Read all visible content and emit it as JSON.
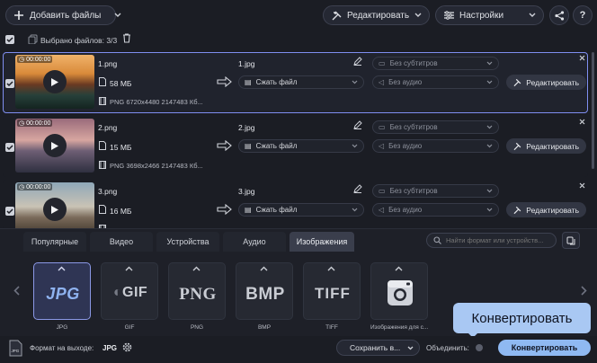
{
  "toolbar": {
    "add_files_label": "Добавить файлы",
    "edit_label": "Редактировать",
    "settings_label": "Настройки"
  },
  "selection": {
    "selected_label": "Выбрано файлов: 3/3"
  },
  "files": [
    {
      "duration": "00:00:00",
      "name": "1.png",
      "size": "58 МБ",
      "info": "PNG 6720x4480 2147483 Кб...",
      "output_name": "1.jpg",
      "compress_label": "Сжать файл",
      "subtitles_label": "Без субтитров",
      "audio_label": "Без аудио",
      "edit_label": "Редактировать"
    },
    {
      "duration": "00:00:00",
      "name": "2.png",
      "size": "15 МБ",
      "info": "PNG 3698x2466 2147483 Кб...",
      "output_name": "2.jpg",
      "compress_label": "Сжать файл",
      "subtitles_label": "Без субтитров",
      "audio_label": "Без аудио",
      "edit_label": "Редактировать"
    },
    {
      "duration": "00:00:00",
      "name": "3.png",
      "size": "16 МБ",
      "info": "",
      "output_name": "3.jpg",
      "compress_label": "Сжать файл",
      "subtitles_label": "Без субтитров",
      "audio_label": "Без аудио",
      "edit_label": "Редактировать"
    }
  ],
  "tabs": [
    {
      "label": "Популярные"
    },
    {
      "label": "Видео"
    },
    {
      "label": "Устройства"
    },
    {
      "label": "Аудио"
    },
    {
      "label": "Изображения",
      "active": true
    }
  ],
  "search": {
    "placeholder": "Найти формат или устройств..."
  },
  "formats": [
    {
      "name": "JPG",
      "label": "JPG",
      "selected": true
    },
    {
      "name": "GIF",
      "label": "GIF"
    },
    {
      "name": "PNG",
      "label": "PNG"
    },
    {
      "name": "BMP",
      "label": "BMP"
    },
    {
      "name": "TIFF",
      "label": "TIFF"
    },
    {
      "name": "",
      "label": "Изображения для с..."
    }
  ],
  "tooltip": {
    "text": "Конвертировать"
  },
  "footer": {
    "output_format_label": "Формат на выходе:",
    "output_format_value": "JPG",
    "save_label": "Сохранить в...",
    "merge_label": "Объединить:",
    "convert_label": "Конвертировать"
  },
  "colors": {
    "accent": "#8fb9f2",
    "selected_row_border": "#7f8ef0",
    "background": "#1b1d24"
  }
}
